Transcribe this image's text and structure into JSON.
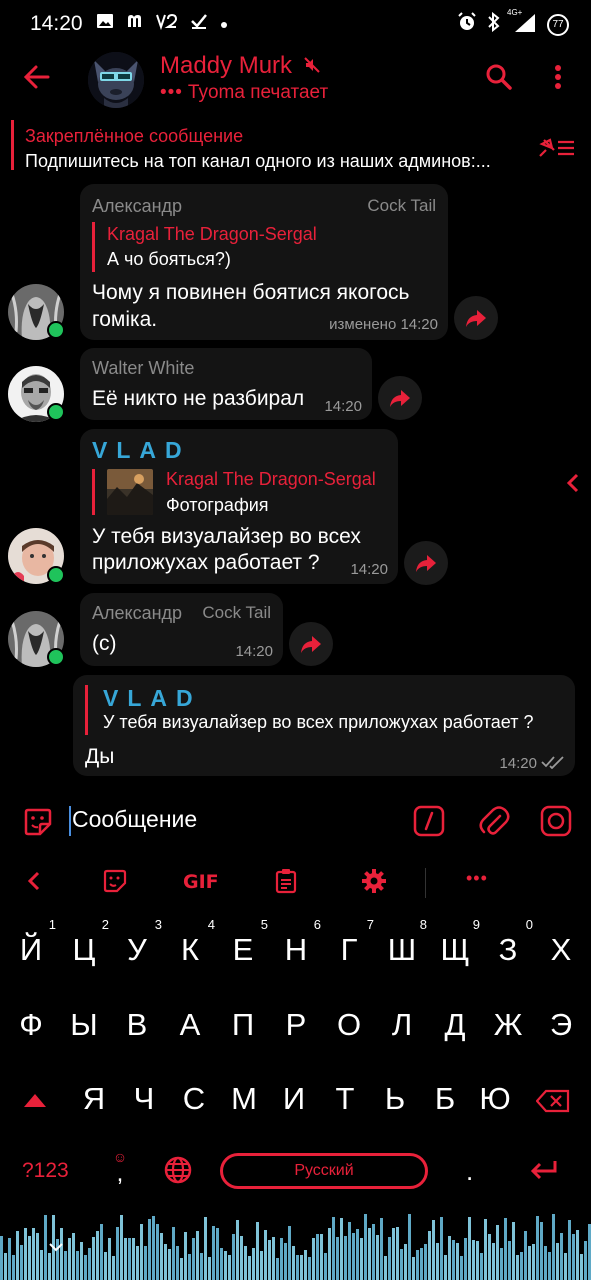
{
  "status_bar": {
    "time": "14:20",
    "icons_left": [
      "image-icon",
      "m-icon",
      "vpn-icon",
      "check-icon",
      "dot-icon"
    ],
    "icons_right": [
      "alarm-icon",
      "bluetooth-icon",
      "signal-icon",
      "battery-icon"
    ],
    "network": "4G+",
    "battery": "77"
  },
  "header": {
    "title": "Maddy Murk",
    "typing_dots": "•••",
    "subtitle": "Tyoma печатает",
    "muted": true
  },
  "pinned": {
    "title": "Закреплённое сообщение",
    "text": "Подпишитесь на топ канал одного из наших админов:..."
  },
  "messages": [
    {
      "sender": "Александр",
      "tag": "Cock Tail",
      "reply_name": "Kragal The Dragon-Sergal",
      "reply_text": "А чо бояться?)",
      "text_line1": "Чому я повинен боятися якогось",
      "text_line2": "гоміка.",
      "time": "изменено 14:20"
    },
    {
      "sender": "Walter White",
      "text_line1": "Её никто не разбирал",
      "time": "14:20"
    },
    {
      "sender": "VLAD",
      "reply_name": "Kragal The Dragon-Sergal",
      "reply_text": "Фотография",
      "text_line1": "У тебя визуалайзер во всех",
      "text_line2": "приложухах работает ?",
      "time": "14:20"
    },
    {
      "sender": "Александр",
      "tag": "Cock Tail",
      "text_line1": "(с)",
      "time": "14:20"
    },
    {
      "reply_name": "VLAD",
      "reply_text": "У тебя визуалайзер во всех приложухах работает ?",
      "text_line1": "Ды",
      "time": "14:20",
      "outgoing": true,
      "read": true
    }
  ],
  "input": {
    "placeholder": "Сообщение"
  },
  "keyboard": {
    "toolbar": [
      "chevron-left-icon",
      "sticker-icon",
      "gif-icon",
      "clipboard-icon",
      "gear-icon",
      "more-icon"
    ],
    "gif_label": "GIF",
    "more_label": "•••",
    "row1": [
      "Й",
      "Ц",
      "У",
      "К",
      "Е",
      "Н",
      "Г",
      "Ш",
      "Щ",
      "З",
      "Х"
    ],
    "row1_hints": [
      "1",
      "2",
      "3",
      "4",
      "5",
      "6",
      "7",
      "8",
      "9",
      "0",
      ""
    ],
    "row2": [
      "Ф",
      "Ы",
      "В",
      "А",
      "П",
      "Р",
      "О",
      "Л",
      "Д",
      "Ж",
      "Э"
    ],
    "row3": [
      "Я",
      "Ч",
      "С",
      "М",
      "И",
      "Т",
      "Ь",
      "Б",
      "Ю"
    ],
    "numbers_key": "?123",
    "comma_key": ",",
    "space_label": "Русский",
    "period_key": ".",
    "accent_color": "#e8213a"
  },
  "colors": {
    "accent": "#e8213a",
    "online": "#1fc35b",
    "vlad": "#37a7d8",
    "bubble": "#141414"
  }
}
